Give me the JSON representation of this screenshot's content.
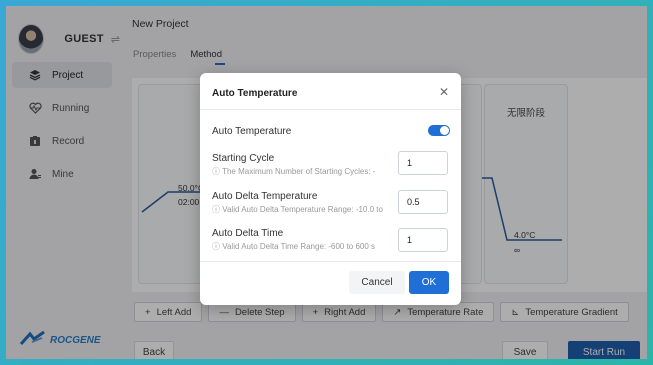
{
  "sidebar": {
    "user": {
      "name": "GUEST",
      "switch_icon": "⇌"
    },
    "items": [
      {
        "label": "Project",
        "icon": "layers-icon",
        "active": true
      },
      {
        "label": "Running",
        "icon": "heartbeat-icon",
        "active": false
      },
      {
        "label": "Record",
        "icon": "record-icon",
        "active": false
      },
      {
        "label": "Mine",
        "icon": "person-icon",
        "active": false
      }
    ],
    "logo_text": "ROCGENE"
  },
  "header": {
    "title": "New Project"
  },
  "tabs": [
    {
      "label": "Properties",
      "active": false
    },
    {
      "label": "Method",
      "active": true
    }
  ],
  "stages": {
    "left": {
      "temp": "50.0°C",
      "time": "02:00"
    },
    "right": {
      "title": "无限阶段",
      "temp": "4.0°C",
      "time": "∞"
    }
  },
  "toolbar": {
    "left_add": "Left Add",
    "delete_step": "Delete Step",
    "right_add": "Right Add",
    "temperature_rate": "Temperature Rate",
    "temperature_gradient": "Temperature Gradient"
  },
  "footer": {
    "back": "Back",
    "save": "Save",
    "start_run": "Start Run"
  },
  "dialog": {
    "title": "Auto Temperature",
    "auto_temp_label": "Auto Temperature",
    "auto_temp_enabled": true,
    "starting_cycle": {
      "label": "Starting Cycle",
      "hint": "ⓘ The Maximum Number of Starting Cycles: -",
      "value": "1"
    },
    "auto_delta_temp": {
      "label": "Auto Delta Temperature",
      "hint": "ⓘ Valid Auto Delta Temperature Range: -10.0 to",
      "value": "0.5"
    },
    "auto_delta_time": {
      "label": "Auto Delta Time",
      "hint": "ⓘ Valid Auto Delta Time Range: -600 to 600 s",
      "value": "1"
    },
    "cancel": "Cancel",
    "ok": "OK"
  },
  "colors": {
    "primary": "#1f6fd6",
    "start_run": "#1f5fae"
  }
}
